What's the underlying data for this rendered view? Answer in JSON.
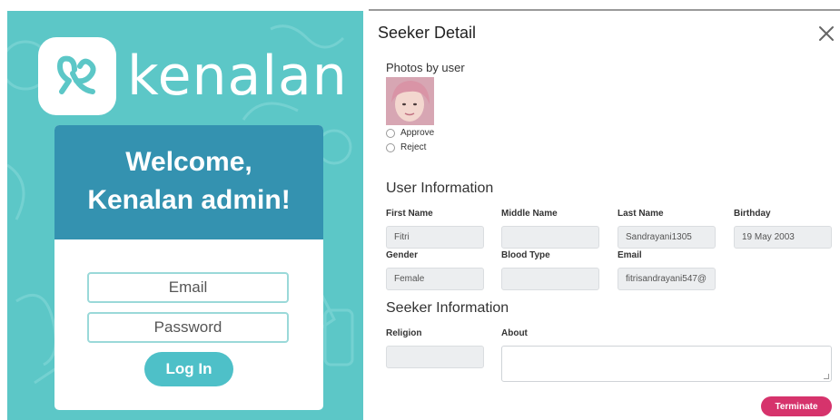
{
  "login": {
    "brand": "kenalan",
    "welcome_line1": "Welcome,",
    "welcome_line2": "Kenalan admin!",
    "email_placeholder": "Email",
    "password_placeholder": "Password",
    "login_label": "Log In",
    "colors": {
      "background": "#5cc7c7",
      "card_header": "#3492b0",
      "button": "#4ec0c8"
    }
  },
  "modal": {
    "title": "Seeker Detail",
    "close_icon": "close-icon",
    "photos_label": "Photos by user",
    "approve_label": "Approve",
    "reject_label": "Reject",
    "user_info": {
      "title": "User Information",
      "first_name": {
        "label": "First Name",
        "value": "Fitri"
      },
      "middle_name": {
        "label": "Middle Name",
        "value": ""
      },
      "last_name": {
        "label": "Last Name",
        "value": "Sandrayani1305"
      },
      "birthday": {
        "label": "Birthday",
        "value": "19 May 2003"
      },
      "gender": {
        "label": "Gender",
        "value": "Female"
      },
      "blood_type": {
        "label": "Blood Type",
        "value": ""
      },
      "email": {
        "label": "Email",
        "value": "fitrisandrayani547@"
      }
    },
    "seeker_info": {
      "title": "Seeker Information",
      "religion": {
        "label": "Religion",
        "value": ""
      },
      "about": {
        "label": "About",
        "value": ""
      }
    },
    "terminate_label": "Terminate",
    "colors": {
      "terminate": "#d6336c"
    }
  }
}
